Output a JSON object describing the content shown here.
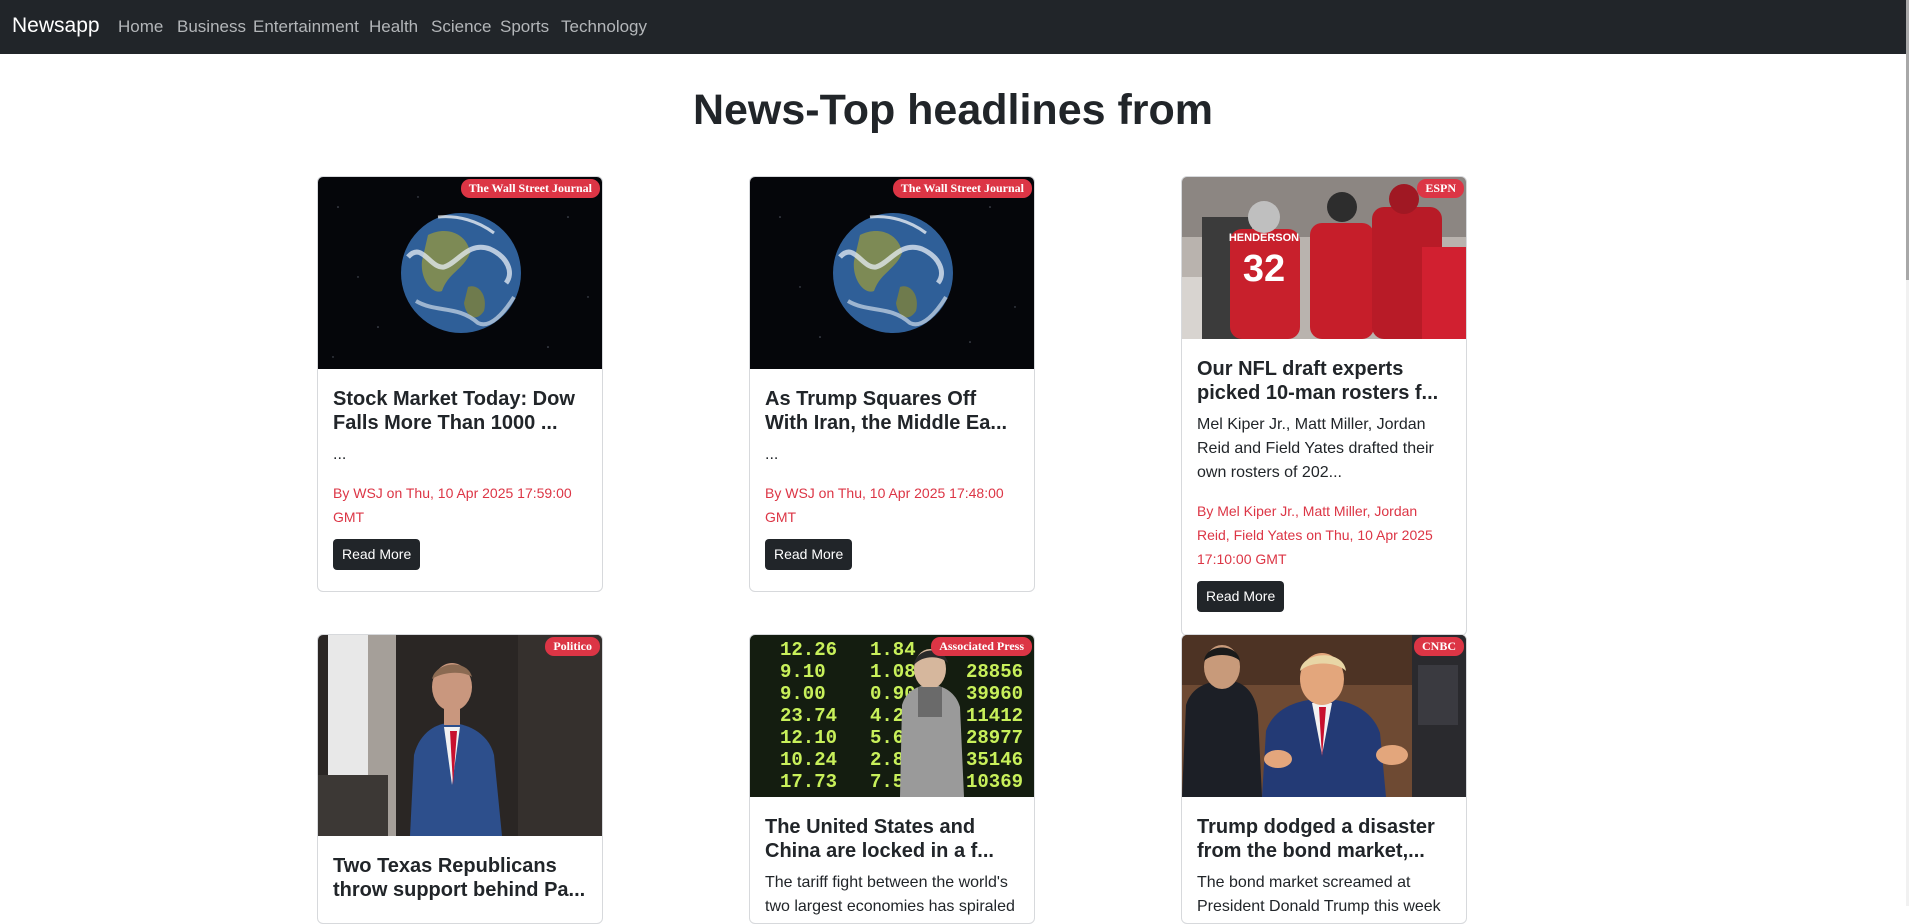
{
  "nav": {
    "brand": "Newsapp",
    "links": [
      "Home",
      "Business",
      "Entertainment",
      "Health",
      "Science",
      "Sports",
      "Technology"
    ]
  },
  "page_title": "News-Top headlines from",
  "cards": [
    {
      "source": "The Wall Street Journal",
      "title": "Stock Market Today: Dow Falls More Than 1000 ...",
      "description": "...",
      "meta": "By WSJ on Thu, 10 Apr 2025 17:59:00 GMT",
      "button": "Read More",
      "image": "earth-from-space"
    },
    {
      "source": "The Wall Street Journal",
      "title": "As Trump Squares Off With Iran, the Middle Ea...",
      "description": "...",
      "meta": "By WSJ on Thu, 10 Apr 2025 17:48:00 GMT",
      "button": "Read More",
      "image": "earth-from-space"
    },
    {
      "source": "ESPN",
      "title": "Our NFL draft experts picked 10-man rosters f...",
      "description": "Mel Kiper Jr., Matt Miller, Jordan Reid and Field Yates drafted their own rosters of 202...",
      "meta": "By Mel Kiper Jr., Matt Miller, Jordan Reid, Field Yates on Thu, 10 Apr 2025 17:10:00 GMT",
      "button": "Read More",
      "image": "football-players"
    },
    {
      "source": "Politico",
      "title": "Two Texas Republicans throw support behind Pa...",
      "image": "man-in-blue-suit"
    },
    {
      "source": "Associated Press",
      "title": "The United States and China are locked in a f...",
      "description": "The tariff fight between the world's two largest economies has spiraled",
      "image": "stock-board"
    },
    {
      "source": "CNBC",
      "title": "Trump dodged a disaster from the bond market,...",
      "description": "The bond market screamed at President Donald Trump this week",
      "image": "president-at-table"
    }
  ],
  "image_text": {
    "jersey_name": "HENDERSON",
    "jersey_number": "32",
    "board_left": [
      "12.26",
      "9.10",
      "9.00",
      "23.74",
      "12.10",
      "10.24",
      "17.73"
    ],
    "board_mid": [
      "1.84",
      "1.08",
      "0.90",
      "4.22",
      "5.62",
      "2.82",
      "7.5"
    ],
    "board_right": [
      "",
      "28856",
      "39960",
      "11412",
      "28977",
      "35146",
      "10369"
    ]
  },
  "colors": {
    "navbar": "#212529",
    "badge": "#dc3545",
    "meta_text": "#dc3545",
    "button": "#212529"
  }
}
